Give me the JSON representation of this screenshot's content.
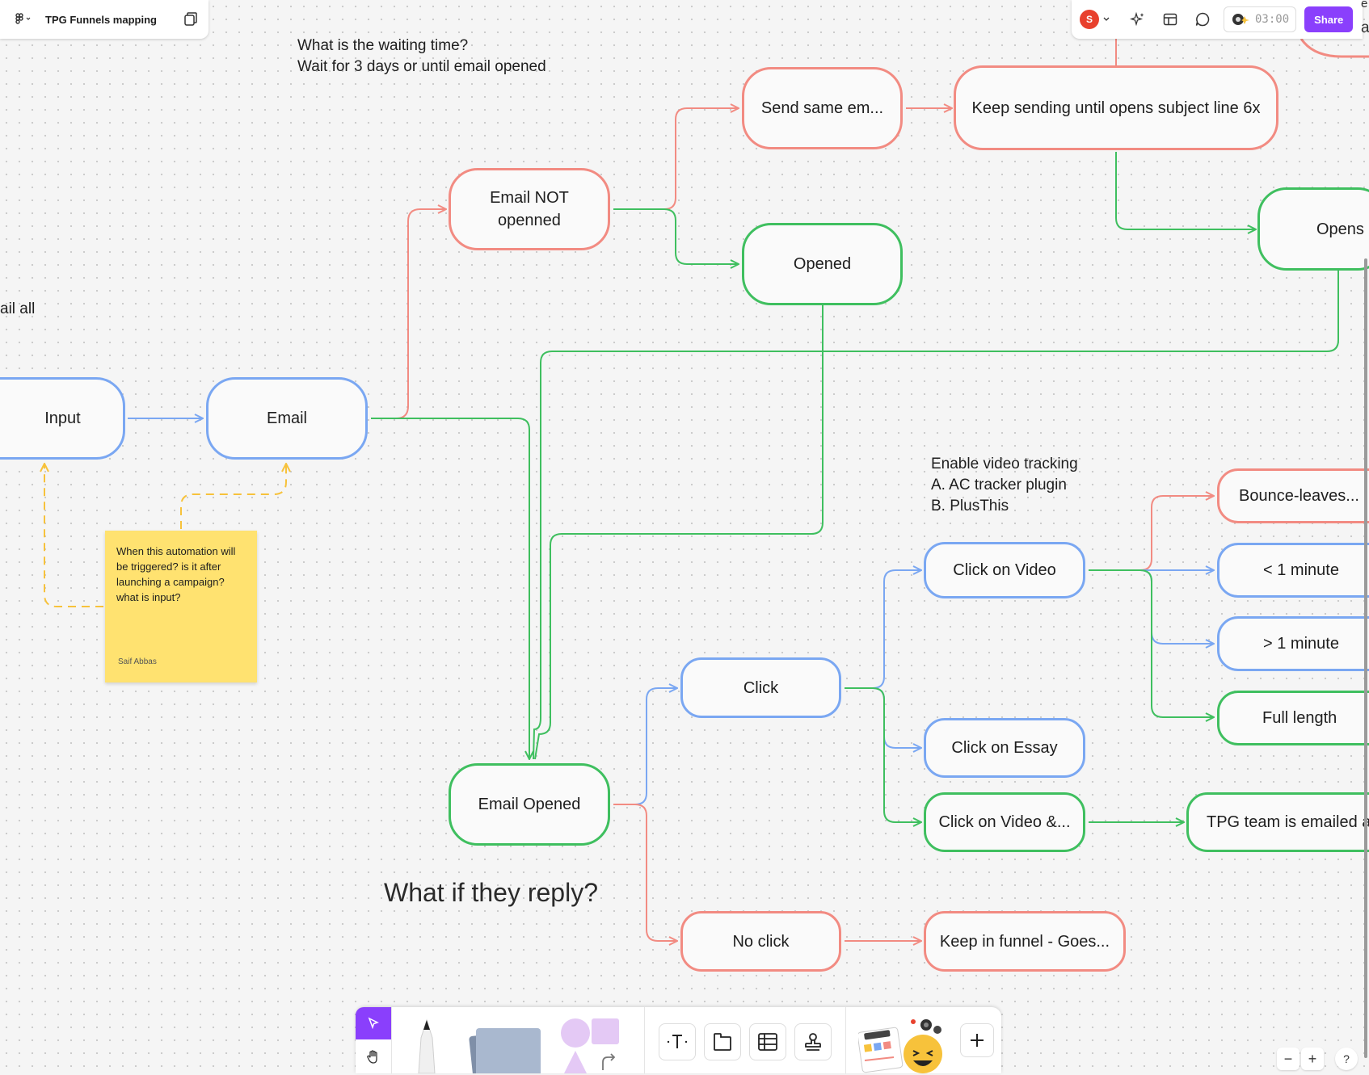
{
  "header": {
    "file_name": "TPG Funnels mapping"
  },
  "top_right": {
    "user_initial": "S",
    "timer": "03:00",
    "share_label": "Share",
    "edge_text_1": "e",
    "edge_text_2": "at"
  },
  "canvas_text": {
    "waiting_line1": "What is the waiting time?",
    "waiting_line2": "Wait for 3 days or until email opened",
    "partial_left": "ail all",
    "video_line1": "Enable video tracking",
    "video_line2": "A. AC tracker plugin",
    "video_line3": "B. PlusThis",
    "reply_question": "What if they reply?"
  },
  "sticky_note": {
    "text": "When this automation will be triggered? is it after launching a campaign? what is input?",
    "author": "Saif Abbas"
  },
  "nodes": {
    "input": "Input",
    "email": "Email",
    "email_not_opened_line1": "Email NOT",
    "email_not_opened_line2": "openned",
    "send_same_email": "Send same em...",
    "keep_sending": "Keep sending until opens subject line 6x",
    "opened": "Opened",
    "opens": "Opens",
    "email_opened": "Email Opened",
    "click": "Click",
    "no_click": "No click",
    "keep_in_funnel": "Keep in funnel - Goes...",
    "click_on_video": "Click on Video",
    "click_on_essay": "Click on Essay",
    "click_on_video_and": "Click on Video &...",
    "tpg_team_emailed": "TPG team is emailed a...",
    "bounce_leaves": "Bounce-leaves...",
    "less_1_minute": "< 1 minute",
    "more_1_minute": "> 1 minute",
    "full_length": "Full length"
  },
  "colors": {
    "red": "#f28b82",
    "green": "#3fbf5f",
    "blue": "#7aa7f2",
    "yellow": "#f7c23b",
    "sticky": "#ffe270",
    "accent": "#8a3ffc"
  },
  "toolbar": {
    "tools": [
      "select-tool",
      "hand-tool",
      "marker-tool",
      "sticky-notes-tool",
      "shapes-tool",
      "text-tool",
      "section-tool",
      "table-tool",
      "stamp-tool",
      "widgets-tool",
      "add-tool"
    ]
  },
  "zoom": {
    "minus": "−",
    "plus": "+",
    "help": "?"
  }
}
